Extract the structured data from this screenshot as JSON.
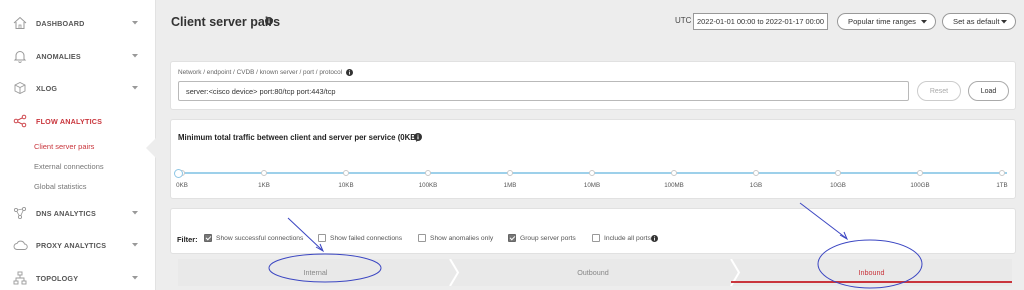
{
  "sidebar": {
    "items": [
      {
        "label": "DASHBOARD",
        "icon": "home-icon"
      },
      {
        "label": "ANOMALIES",
        "icon": "bell-icon"
      },
      {
        "label": "XLOG",
        "icon": "box-icon"
      },
      {
        "label": "FLOW ANALYTICS",
        "icon": "share-icon",
        "active": true
      },
      {
        "label": "DNS ANALYTICS",
        "icon": "network-icon"
      },
      {
        "label": "PROXY ANALYTICS",
        "icon": "cloud-icon"
      },
      {
        "label": "TOPOLOGY",
        "icon": "topology-icon"
      }
    ],
    "flow_sub": [
      {
        "label": "Client server pairs",
        "active": true
      },
      {
        "label": "External connections"
      },
      {
        "label": "Global statistics"
      }
    ]
  },
  "header": {
    "title": "Client server pairs",
    "utc_label": "UTC",
    "date_range": "2022-01-01 00:00 to 2022-01-17 00:00",
    "popular_label": "Popular time ranges",
    "default_label": "Set as default"
  },
  "query": {
    "label": "Network / endpoint / CVDB / known server / port / protocol",
    "value": "server:<cisco device> port:80/tcp port:443/tcp",
    "reset_label": "Reset",
    "load_label": "Load"
  },
  "slider": {
    "title": "Minimum total traffic between client and server per service",
    "current": "(0KB)",
    "ticks": [
      "0KB",
      "1KB",
      "10KB",
      "100KB",
      "1MB",
      "10MB",
      "100MB",
      "1GB",
      "10GB",
      "100GB",
      "1TB"
    ],
    "value_index": 0
  },
  "filter": {
    "label": "Filter:",
    "options": [
      {
        "label": "Show successful connections",
        "checked": true
      },
      {
        "label": "Show failed connections",
        "checked": false
      },
      {
        "label": "Show anomalies only",
        "checked": false
      },
      {
        "label": "Group server ports",
        "checked": true
      },
      {
        "label": "Include all ports",
        "checked": false
      }
    ]
  },
  "tabs": [
    {
      "label": "Internal",
      "active": false
    },
    {
      "label": "Outbound",
      "active": false
    },
    {
      "label": "Inbound",
      "active": true
    }
  ],
  "colors": {
    "accent": "#c9353c",
    "slider": "#9dd0ea",
    "annotation": "#3b46c2"
  }
}
